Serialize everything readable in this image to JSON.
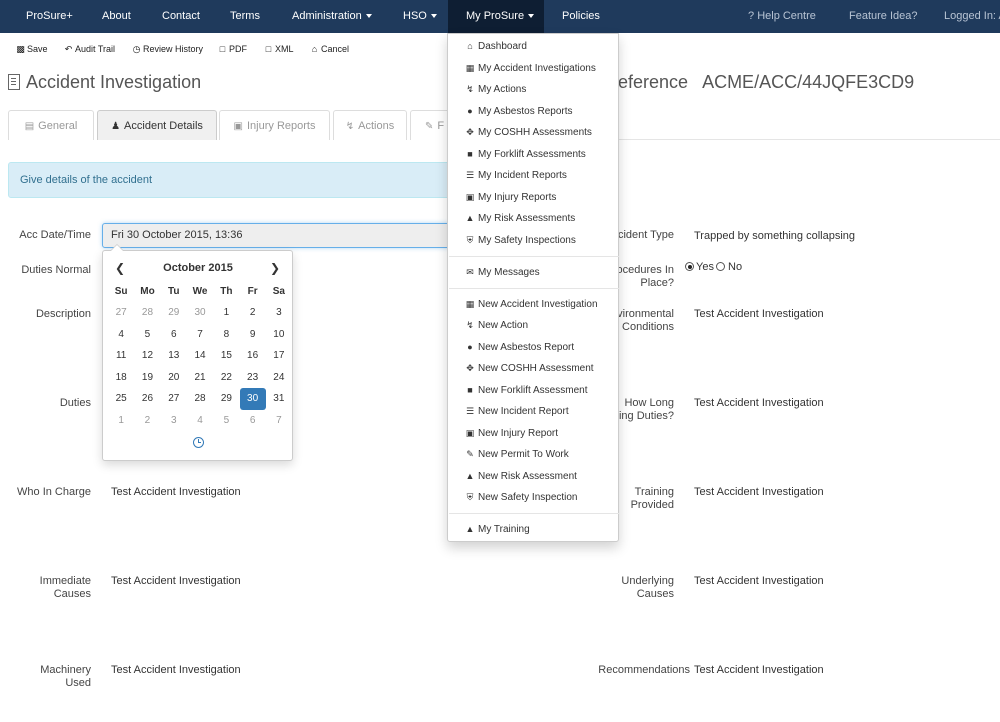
{
  "navbar": {
    "brand": "ProSure+",
    "about": "About",
    "contact": "Contact",
    "terms": "Terms",
    "administration": "Administration",
    "hso": "HSO",
    "my_prosure": "My ProSure",
    "policies": "Policies",
    "help_centre": "Help Centre",
    "feature_idea": "Feature Idea?",
    "logged_in": "Logged In: A"
  },
  "toolbar": {
    "save": "Save",
    "audit_trail": "Audit Trail",
    "review_history": "Review History",
    "pdf": "PDF",
    "xml": "XML",
    "cancel": "Cancel"
  },
  "page": {
    "title": "Accident Investigation",
    "reference_label": "eference",
    "reference_value": "ACME/ACC/44JQFE3CD9"
  },
  "tabs": {
    "general": "General",
    "accident_details": "Accident Details",
    "injury_reports": "Injury Reports",
    "actions": "Actions",
    "partial": "F"
  },
  "info": "Give details of the accident",
  "form": {
    "acc_date_label": "Acc Date/Time",
    "acc_date_value": "Fri 30 October 2015, 13:36",
    "duties_normal_label": "Duties Normal",
    "description_label": "Description",
    "duties_label": "Duties",
    "who_in_charge_label": "Who In Charge",
    "who_in_charge_value": "Test Accident Investigation",
    "immediate_causes_label_1": "Immediate",
    "immediate_causes_label_2": "Causes",
    "immediate_causes_value": "Test Accident Investigation",
    "machinery_used_label_1": "Machinery",
    "machinery_used_label_2": "Used",
    "machinery_used_value": "Test Accident Investigation",
    "accident_type_label": "ccident Type",
    "accident_type_value": "Trapped by something collapsing",
    "procedures_label_1": "rocedures In",
    "procedures_label_2": "Place?",
    "procedures_yes": "Yes",
    "procedures_no": "No",
    "procedures_selected": "Yes",
    "environmental_label_1": "nvironmental",
    "environmental_label_2": "Conditions",
    "environmental_value": "Test Accident Investigation",
    "how_long_label_1": "How Long",
    "how_long_label_2": "ping Duties?",
    "how_long_value": "Test Accident Investigation",
    "training_label_1": "Training",
    "training_label_2": "Provided",
    "training_value": "Test Accident Investigation",
    "underlying_label_1": "Underlying",
    "underlying_label_2": "Causes",
    "underlying_value": "Test Accident Investigation",
    "recommendations_label": "Recommendations",
    "recommendations_value": "Test Accident Investigation"
  },
  "datepicker": {
    "month": "October 2015",
    "weekdays": [
      "Su",
      "Mo",
      "Tu",
      "We",
      "Th",
      "Fr",
      "Sa"
    ],
    "weeks": [
      [
        "27",
        "28",
        "29",
        "30",
        "1",
        "2",
        "3"
      ],
      [
        "4",
        "5",
        "6",
        "7",
        "8",
        "9",
        "10"
      ],
      [
        "11",
        "12",
        "13",
        "14",
        "15",
        "16",
        "17"
      ],
      [
        "18",
        "19",
        "20",
        "21",
        "22",
        "23",
        "24"
      ],
      [
        "25",
        "26",
        "27",
        "28",
        "29",
        "30",
        "31"
      ],
      [
        "1",
        "2",
        "3",
        "4",
        "5",
        "6",
        "7"
      ]
    ],
    "muted": [
      [
        0,
        0
      ],
      [
        0,
        1
      ],
      [
        0,
        2
      ],
      [
        0,
        3
      ],
      [
        5,
        0
      ],
      [
        5,
        1
      ],
      [
        5,
        2
      ],
      [
        5,
        3
      ],
      [
        5,
        4
      ],
      [
        5,
        5
      ],
      [
        5,
        6
      ]
    ],
    "selected": [
      4,
      5
    ]
  },
  "menu": {
    "dashboard": "Dashboard",
    "my_accident_investigations": "My Accident Investigations",
    "my_actions": "My Actions",
    "my_asbestos_reports": "My Asbestos Reports",
    "my_coshh_assessments": "My COSHH Assessments",
    "my_forklift_assessments": "My Forklift Assessments",
    "my_incident_reports": "My Incident Reports",
    "my_injury_reports": "My Injury Reports",
    "my_risk_assessments": "My Risk Assessments",
    "my_safety_inspections": "My Safety Inspections",
    "my_messages": "My Messages",
    "new_accident_investigation": "New Accident Investigation",
    "new_action": "New Action",
    "new_asbestos_report": "New Asbestos Report",
    "new_coshh_assessment": "New COSHH Assessment",
    "new_forklift_assessment": "New Forklift Assessment",
    "new_incident_report": "New Incident Report",
    "new_injury_report": "New Injury Report",
    "new_permit_to_work": "New Permit To Work",
    "new_risk_assessment": "New Risk Assessment",
    "new_safety_inspection": "New Safety Inspection",
    "my_training": "My Training"
  },
  "colors": {
    "navbar_bg": "#1f3a5c",
    "navbar_active": "#0e1e33",
    "info_bg": "#d9edf7",
    "info_text": "#31708f",
    "selected_day": "#337ab7"
  },
  "icons": {
    "save": "floppy-icon",
    "audit_trail": "undo-icon",
    "review_history": "history-icon",
    "pdf": "file-icon",
    "xml": "file-code-icon",
    "cancel": "home-icon"
  }
}
